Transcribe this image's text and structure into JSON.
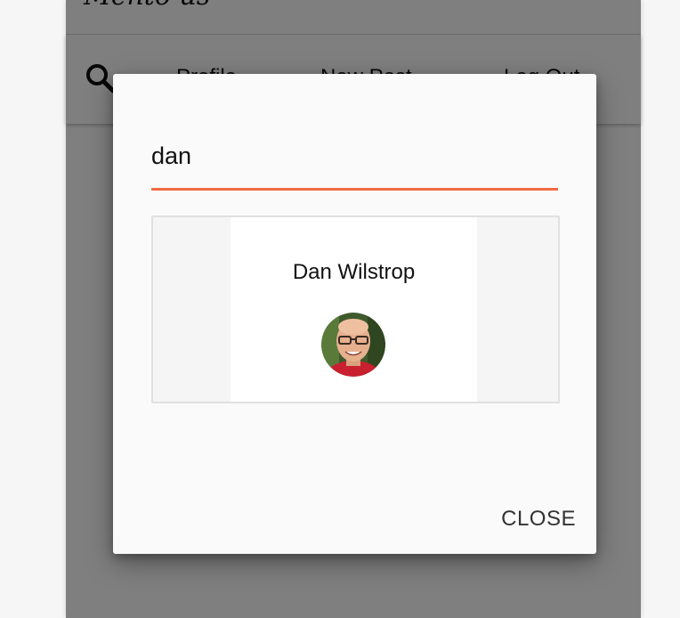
{
  "app": {
    "title": "Mento us"
  },
  "nav": {
    "search_icon": "search-icon",
    "items": [
      {
        "label": "Profile"
      },
      {
        "label": "New Post"
      },
      {
        "label": "Log Out"
      }
    ]
  },
  "dialog": {
    "search": {
      "value": "dan"
    },
    "results": [
      {
        "name": "Dan Wilstrop",
        "avatar": "profile-photo"
      }
    ],
    "close_label": "CLOSE"
  },
  "colors": {
    "accent": "#f26b43",
    "overlay": "rgba(0,0,0,0.5)",
    "dialog_bg": "#fafafa"
  }
}
